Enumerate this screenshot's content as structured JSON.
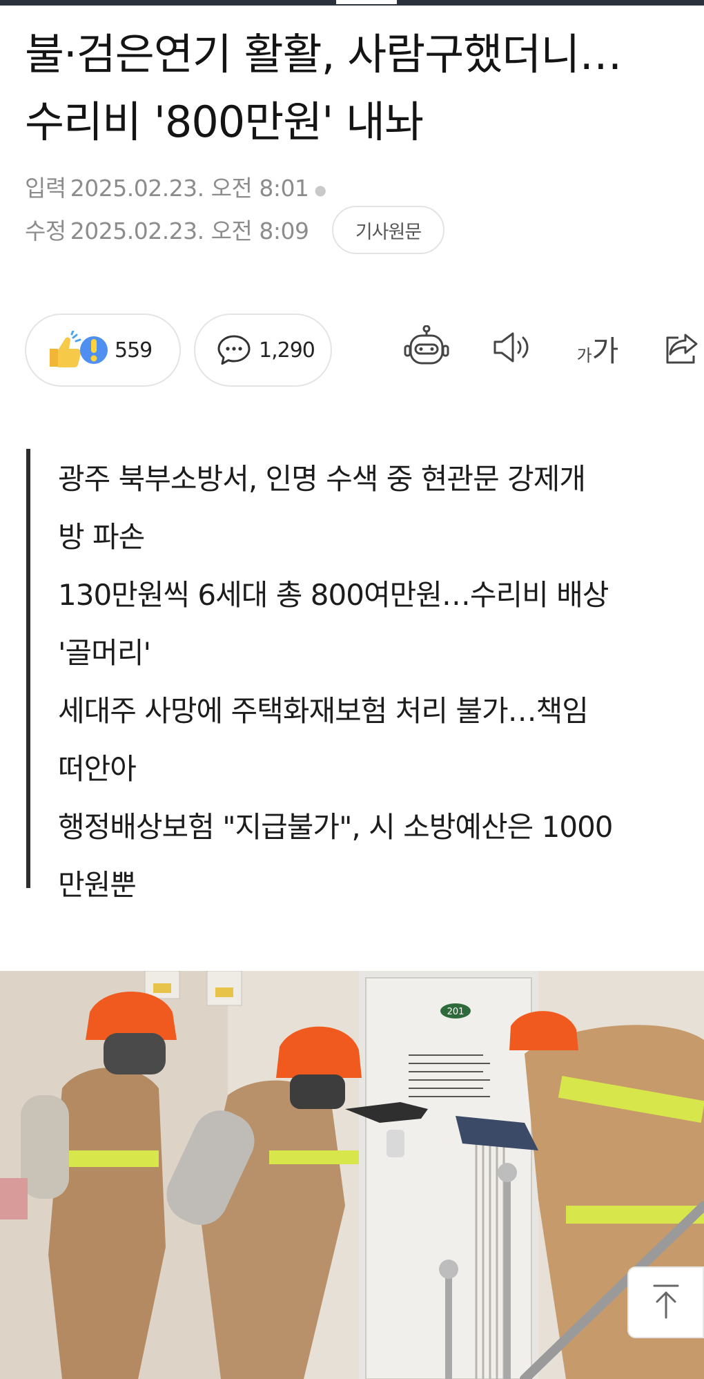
{
  "article": {
    "headline_line1": "불·검은연기 활활, 사람구했더니…",
    "headline_line2": "수리비 '800만원' 내놔",
    "input_label": "입력",
    "input_time": "2025.02.23. 오전 8:01",
    "modified_label": "수정",
    "modified_time": "2025.02.23. 오전 8:09",
    "original_button": "기사원문"
  },
  "actions": {
    "reaction_count": "559",
    "comment_count": "1,290",
    "font_small": "가",
    "font_big": "가"
  },
  "summary": {
    "lines": [
      "광주 북부소방서, 인명 수색 중 현관문 강제개",
      "방 파손",
      "130만원씩 6세대 총 800여만원…수리비 배상",
      "'골머리'",
      "세대주 사망에 주택화재보험 처리 불가…책임",
      "떠안아",
      "행정배상보험 \"지급불가\", 시 소방예산은 1000",
      "만원뿐"
    ]
  },
  "photo": {
    "door_number": "201"
  },
  "icons": {
    "reaction": "thumbs-up-surprise-icon",
    "comment": "speech-bubble-icon",
    "robot": "ai-robot-icon",
    "speaker": "speaker-icon",
    "font": "font-size-icon",
    "share": "share-icon",
    "top": "arrow-up-top-icon"
  },
  "colors": {
    "text": "#141414",
    "meta": "#8c8c8c",
    "summary_bar": "#2d2d2d",
    "helmet": "#f05a1e",
    "reflective": "#d7e64a"
  }
}
